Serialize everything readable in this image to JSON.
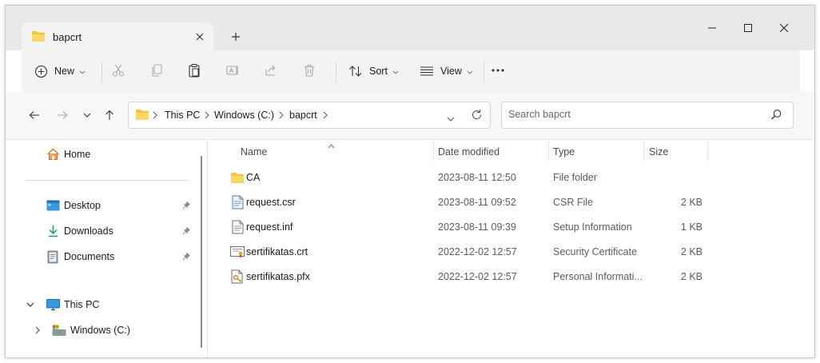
{
  "window": {
    "tab_title": "bapcrt",
    "icons": {
      "tab": "folder-icon",
      "close_tab": "close-icon",
      "new_tab": "plus-icon",
      "minimize": "minimize-icon",
      "maximize": "maximize-icon",
      "close": "close-icon"
    }
  },
  "toolbar": {
    "new_label": "New",
    "sort_label": "Sort",
    "view_label": "View",
    "icons": [
      "plus-circle-icon",
      "cut-icon",
      "copy-icon",
      "paste-icon",
      "rename-icon",
      "share-icon",
      "delete-icon",
      "sort-icon",
      "view-icon",
      "more-icon"
    ]
  },
  "address": {
    "crumbs": [
      "This PC",
      "Windows (C:)",
      "bapcrt"
    ],
    "search_placeholder": "Search bapcrt"
  },
  "nav": {
    "home": "Home",
    "quick": [
      {
        "label": "Desktop",
        "icon": "desktop-icon",
        "pinned": true
      },
      {
        "label": "Downloads",
        "icon": "download-icon",
        "pinned": true
      },
      {
        "label": "Documents",
        "icon": "documents-icon",
        "pinned": true
      }
    ],
    "this_pc": "This PC",
    "drive": "Windows (C:)"
  },
  "columns": {
    "name": "Name",
    "date": "Date modified",
    "type": "Type",
    "size": "Size"
  },
  "files": [
    {
      "name": "CA",
      "date": "2023-08-11 12:50",
      "type": "File folder",
      "size": "",
      "icon": "folder-icon"
    },
    {
      "name": "request.csr",
      "date": "2023-08-11 09:52",
      "type": "CSR File",
      "size": "2 KB",
      "icon": "csr-file-icon"
    },
    {
      "name": "request.inf",
      "date": "2023-08-11 09:39",
      "type": "Setup Information",
      "size": "1 KB",
      "icon": "inf-file-icon"
    },
    {
      "name": "sertifikatas.crt",
      "date": "2022-12-02 12:57",
      "type": "Security Certificate",
      "size": "2 KB",
      "icon": "certificate-icon"
    },
    {
      "name": "sertifikatas.pfx",
      "date": "2022-12-02 12:57",
      "type": "Personal Informati...",
      "size": "2 KB",
      "icon": "pfx-file-icon"
    }
  ],
  "colors": {
    "folder": "#f5c343",
    "accent": "#0067c0",
    "titlebar": "#e9e9e9",
    "toolbar": "#f3f3f3"
  }
}
